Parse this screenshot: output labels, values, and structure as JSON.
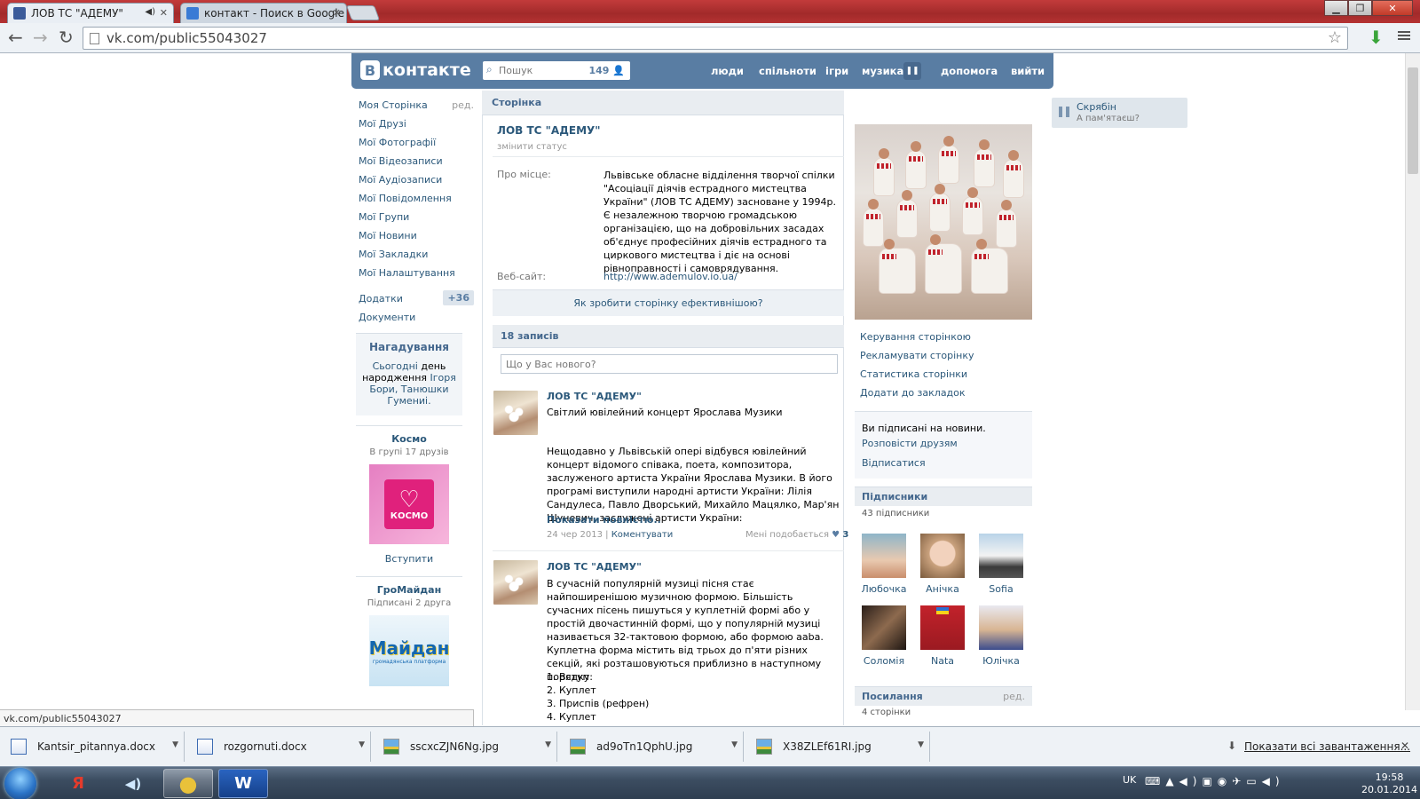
{
  "browser": {
    "tabs": [
      {
        "title": "ЛОВ ТС \"АДЕМУ\"",
        "favicon_color": "#3b5b9a",
        "active": true,
        "audio_icon": "speaker-icon"
      },
      {
        "title": "контакт - Поиск в Google",
        "favicon_color": "#3a7bd5",
        "active": false
      }
    ],
    "url": "vk.com/public55043027",
    "status_url": "vk.com/public55043027"
  },
  "vk": {
    "logo": "контакте",
    "logo_letter": "В",
    "search_placeholder": "Пошук",
    "search_count": "149",
    "nav": [
      "люди",
      "спільноти",
      "ігри",
      "музика",
      "допомога",
      "вийти"
    ],
    "left_menu": [
      "Моя Сторінка",
      "Мої Друзі",
      "Мої Фотографії",
      "Мої Відеозаписи",
      "Мої Аудіозаписи",
      "Мої Повідомлення",
      "Мої Групи",
      "Мої Новини",
      "Мої Закладки",
      "Мої Налаштування"
    ],
    "left_menu_edit": "ред.",
    "apps_label": "Додатки",
    "apps_badge": "+36",
    "docs_label": "Документи",
    "reminder": {
      "title": "Нагадування",
      "text_prefix": "Сьогодні",
      "text_mid": "день народження",
      "names": "Ігоря Бори, Танюшки Гумениі."
    },
    "ad_groups": [
      {
        "name": "Космо",
        "subtitle": "В групі 17 друзів",
        "logo_text": "КОСМО",
        "action": "Вступити"
      },
      {
        "name": "ГроМайдан",
        "subtitle": "Підписані 2 друга",
        "logo_text": "Майдан",
        "logo_sub": "громадянська платформа"
      }
    ],
    "page": {
      "section": "Сторінка",
      "name": "ЛОВ ТС \"АДЕМУ\"",
      "status_link": "змінити статус",
      "about_label": "Про місце:",
      "about_text": "Львівське обласне відділення творчої спілки \"Асоціації діячів естрадного мистецтва України\" (ЛОВ ТС АДЕМУ) засноване у 1994р. Є незалежною творчою громадською організацією, що на добровільних засадах об'єднує професійних діячів естрадного та циркового мистецтва і діє на основі рівноправності і самоврядування.",
      "site_label": "Веб-сайт:",
      "site_url": "http://www.ademulov.io.ua/",
      "effective_link": "Як зробити сторінку ефективнішою?"
    },
    "wall": {
      "count": "18 записів",
      "new_post_placeholder": "Що у Вас нового?",
      "posts": [
        {
          "author": "ЛОВ ТС \"АДЕМУ\"",
          "title": "Світлий ювілейний концерт Ярослава Музики",
          "text": "Нещодавно у Львівській опері відбувся ювілейний концерт відомого співака, поета, композитора, заслуженого артиста України Ярослава Музики. В його програмі виступили народні артисти України: Лілія Сандулеса, Павло Дворський, Михайло Мацялко, Мар'ян Шуневич, заслужені артисти України:",
          "more": "Показати повністю..",
          "date": "24 чер 2013",
          "comment": "Коментувати",
          "like_label": "Мені подобається",
          "likes": "3"
        },
        {
          "author": "ЛОВ ТС \"АДЕМУ\"",
          "text": "В сучасній популярній музиці пісня стає найпоширенішою музичною формою. Більшість сучасних пісень пишуться у куплетній формі або у простій двочастинній формі, що у популярній музиці називається 32-тактовою формою, або формою aaba. Куплетна форма містить від трьох до п'яти різних секцій, які розташовуються приблизно в наступному порядку:",
          "list": [
            "1. Вступ",
            "2. Куплет",
            "3. Приспів (рефрен)",
            "4. Куплет"
          ]
        }
      ]
    },
    "right": {
      "actions": [
        "Керування сторінкою",
        "Рекламувати сторінку",
        "Статистика сторінки",
        "Додати до закладок"
      ],
      "subscribed_text": "Ви підписані на новини.",
      "tell_friends": "Розповісти друзям",
      "unsubscribe": "Відписатися",
      "followers_title": "Підписники",
      "followers_count": "43 підписники",
      "followers": [
        "Любочка",
        "Анічка",
        "Sofia",
        "Соломія",
        "Nata",
        "Юлічка"
      ],
      "links_title": "Посилання",
      "links_edit": "ред.",
      "links_count": "4 сторінки"
    },
    "player": {
      "artist": "Скрябін",
      "song": "А пам'ятаєш?"
    }
  },
  "downloads": {
    "items": [
      {
        "name": "Kantsir_pitannya.docx",
        "type": "doc"
      },
      {
        "name": "rozgornuti.docx",
        "type": "doc"
      },
      {
        "name": "sscxcZJN6Ng.jpg",
        "type": "jpg"
      },
      {
        "name": "ad9oTn1QphU.jpg",
        "type": "jpg"
      },
      {
        "name": "X38ZLEf61RI.jpg",
        "type": "jpg"
      }
    ],
    "show_all": "Показати всі завантаження..."
  },
  "taskbar": {
    "apps": [
      "Я",
      "◀)",
      "●",
      "W"
    ],
    "lang": "UK",
    "time": "19:58",
    "date": "20.01.2014"
  },
  "colors": {
    "vk_blue": "#597da3",
    "vk_link": "#2b587a",
    "chrome_red": "#a22a2a"
  }
}
